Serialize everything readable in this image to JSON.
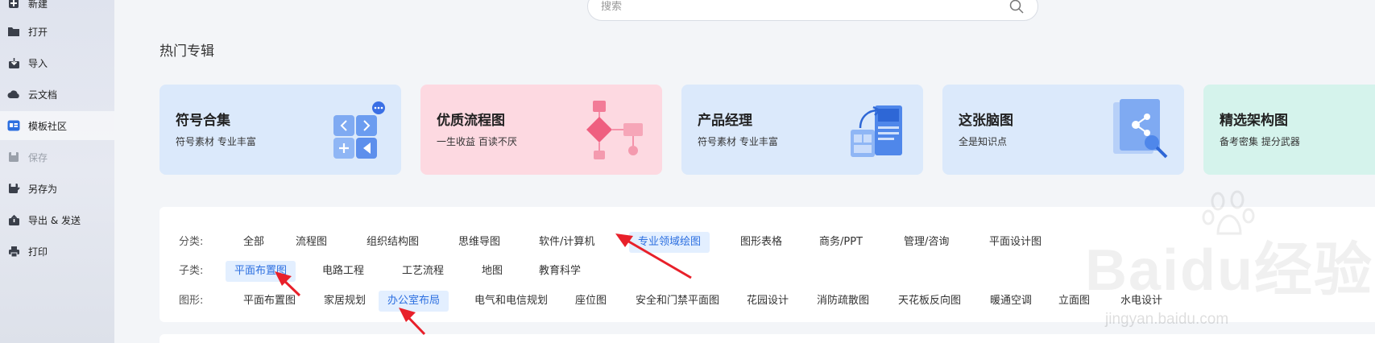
{
  "sidebar": {
    "items": [
      {
        "label": "新建",
        "icon": "new-file-icon"
      },
      {
        "label": "打开",
        "icon": "folder-icon"
      },
      {
        "label": "导入",
        "icon": "import-icon"
      },
      {
        "label": "云文档",
        "icon": "cloud-icon"
      },
      {
        "label": "模板社区",
        "icon": "template-icon",
        "active": true
      },
      {
        "label": "保存",
        "icon": "save-icon",
        "disabled": true
      },
      {
        "label": "另存为",
        "icon": "save-as-icon"
      },
      {
        "label": "导出 & 发送",
        "icon": "export-icon"
      },
      {
        "label": "打印",
        "icon": "print-icon"
      }
    ],
    "new_plus": "+"
  },
  "search": {
    "placeholder": "搜索",
    "icon": "search-icon"
  },
  "hot": {
    "title": "热门专辑",
    "cards": [
      {
        "title": "符号合集",
        "subtitle": "符号素材 专业丰富",
        "bg": "#dbe9fb"
      },
      {
        "title": "优质流程图",
        "subtitle": "一生收益 百读不厌",
        "bg": "#fdd9e1"
      },
      {
        "title": "产品经理",
        "subtitle": "符号素材 专业丰富",
        "bg": "#dbe9fb"
      },
      {
        "title": "这张脑图",
        "subtitle": "全是知识点",
        "bg": "#dbe9fb"
      },
      {
        "title": "精选架构图",
        "subtitle": "备考密集 提分武器",
        "bg": "#d5f3ec"
      }
    ]
  },
  "filters": {
    "category_label": "分类:",
    "categories": [
      "全部",
      "流程图",
      "组织结构图",
      "思维导图",
      "软件/计算机",
      "专业领域绘图",
      "图形表格",
      "商务/PPT",
      "管理/咨询",
      "平面设计图"
    ],
    "category_selected": "专业领域绘图",
    "sub_label": "子类:",
    "subs": [
      "平面布置图",
      "电路工程",
      "工艺流程",
      "地图",
      "教育科学"
    ],
    "sub_selected": "平面布置图",
    "shape_label": "图形:",
    "shapes": [
      "平面布置图",
      "家居规划",
      "办公室布局",
      "电气和电信规划",
      "座位图",
      "安全和门禁平面图",
      "花园设计",
      "消防疏散图",
      "天花板反向图",
      "暖通空调",
      "立面图",
      "水电设计"
    ],
    "shape_selected": "办公室布局"
  },
  "watermark": {
    "brand": "Baidu经验",
    "url": "jingyan.baidu.com"
  },
  "colors": {
    "accent": "#2c6fe0",
    "selected_bg": "#e3efff",
    "arrow": "#e8202a"
  }
}
